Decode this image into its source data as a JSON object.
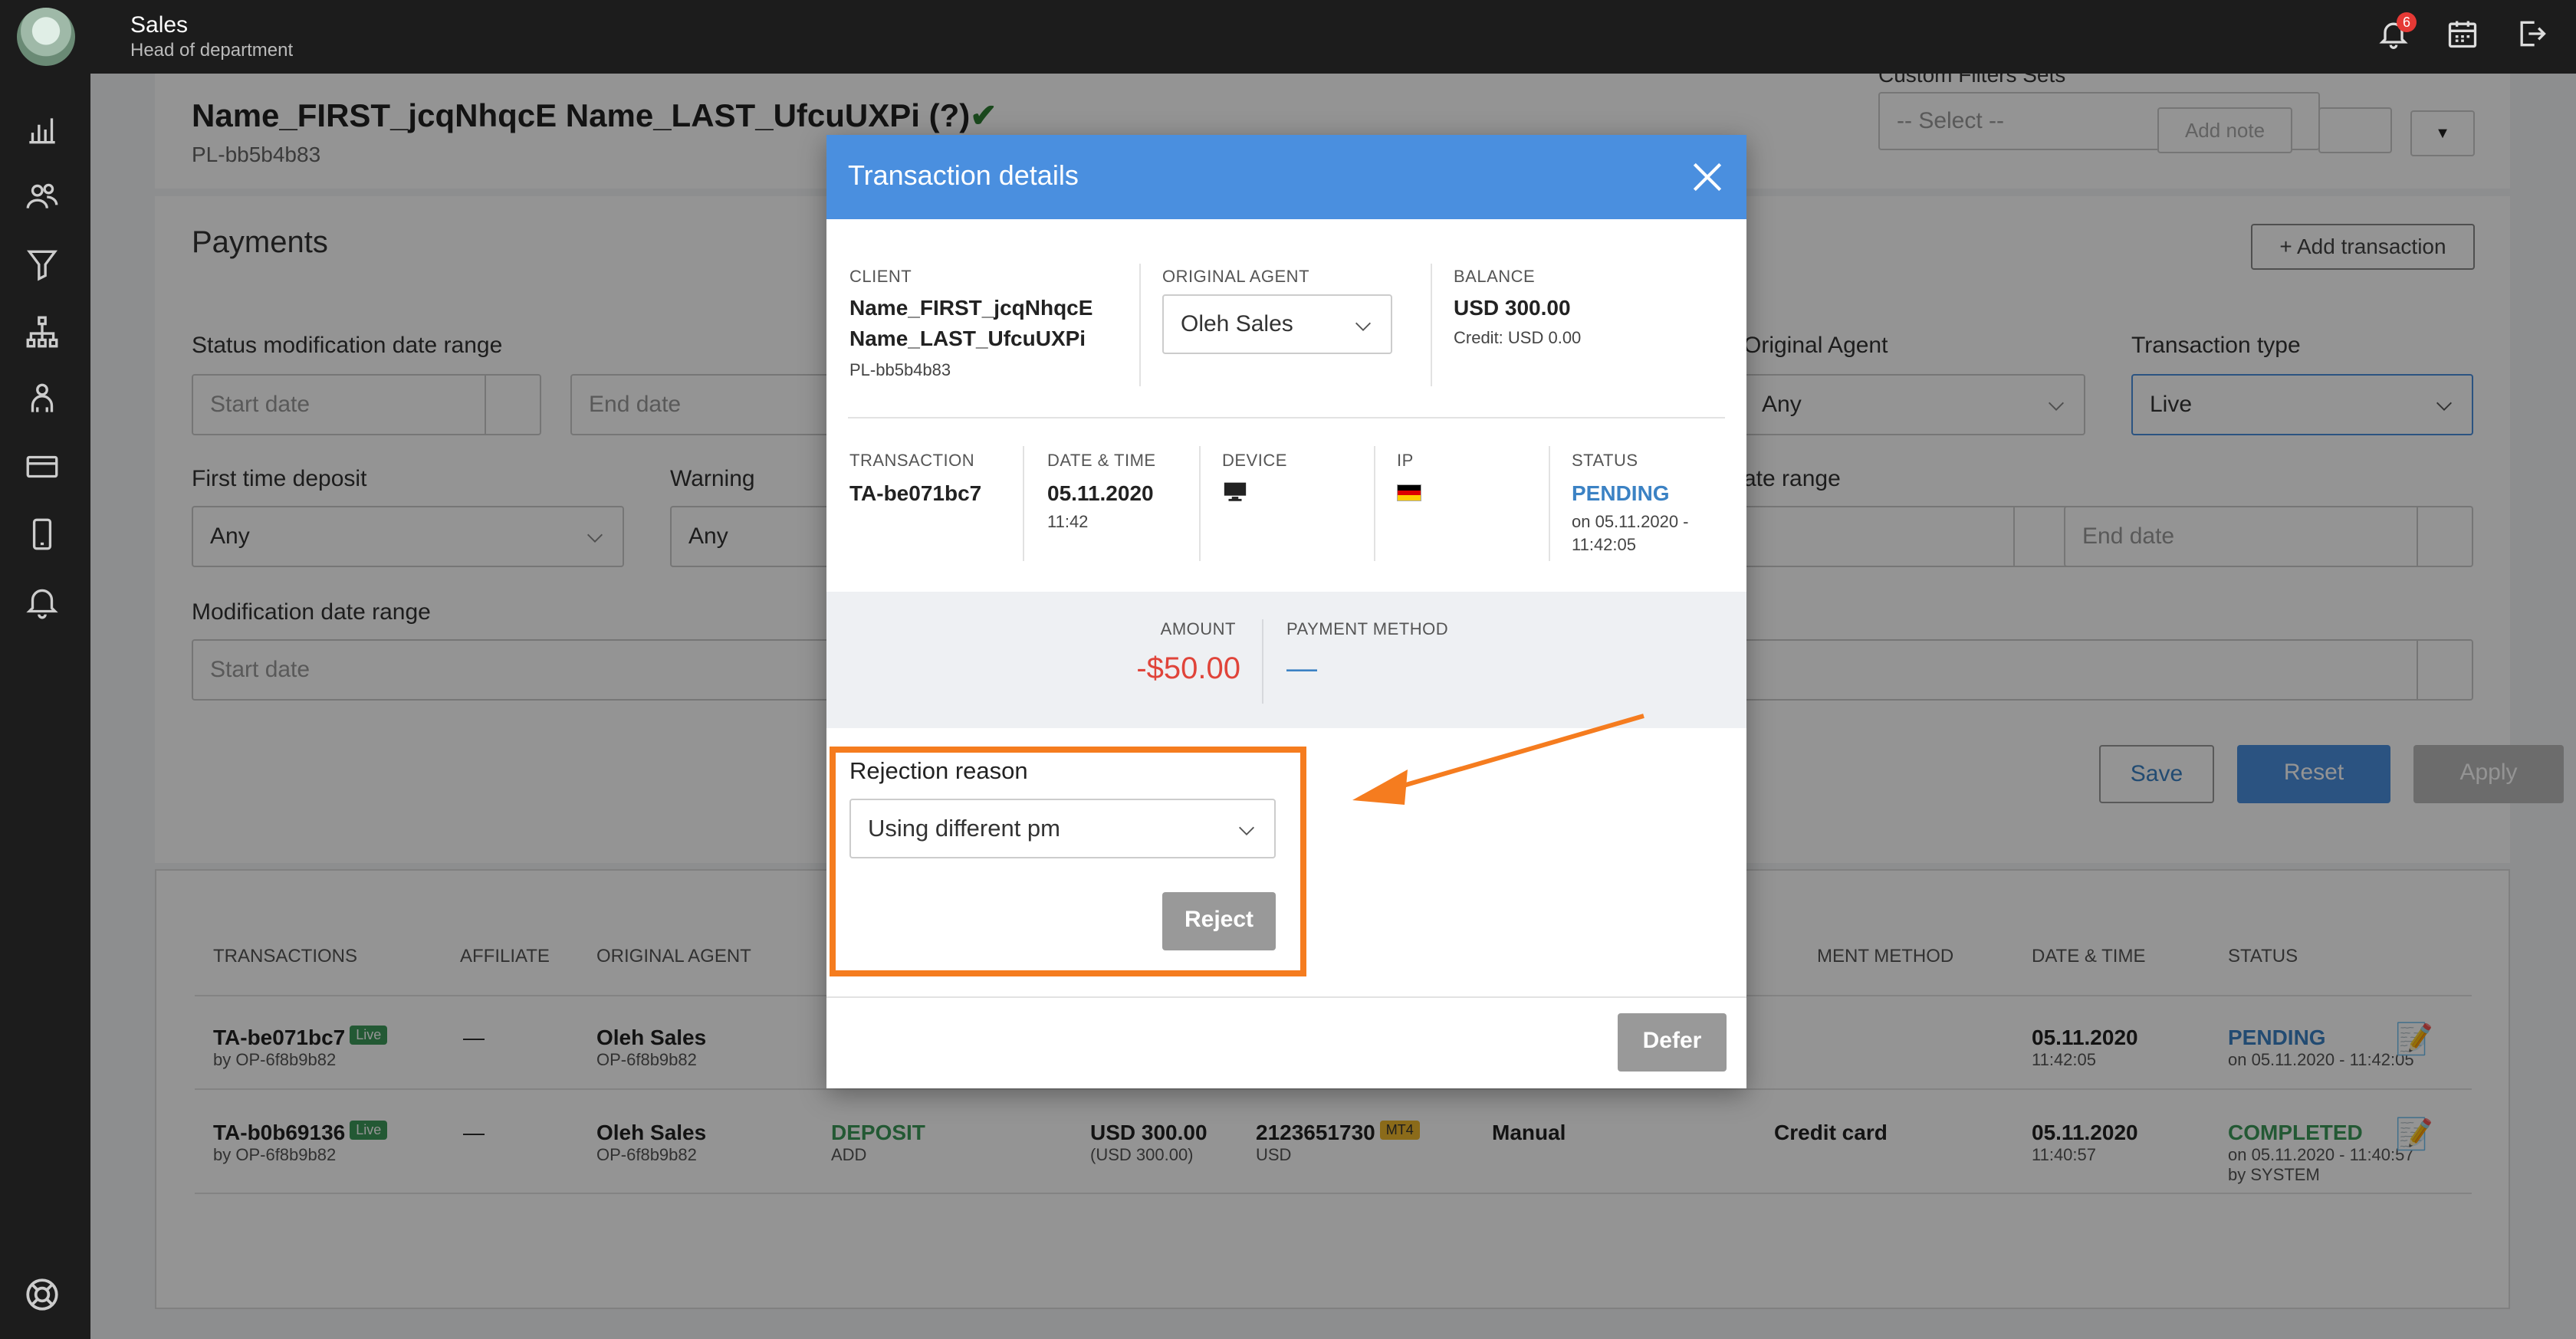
{
  "header": {
    "app_name": "Sales",
    "role": "Head of department",
    "notifications_count": "6"
  },
  "client": {
    "full_name": "Name_FIRST_jcqNhqcE Name_LAST_UfcuUXPi (?)",
    "id": "PL-bb5b4b83"
  },
  "top_controls": {
    "custom_filters_label": "Custom Filters Sets",
    "select_placeholder": "-- Select --",
    "add_note": "Add note"
  },
  "payments": {
    "title": "Payments",
    "add_transaction": "+ Add transaction",
    "filters": {
      "status_mod_label": "Status modification date range",
      "start_date": "Start date",
      "end_date": "End date",
      "original_agent_label": "Original Agent",
      "original_agent_value": "Any",
      "transaction_type_label": "Transaction type",
      "transaction_type_value": "Live",
      "ftd_label": "First time deposit",
      "ftd_value": "Any",
      "warning_label": "Warning",
      "warning_value": "Any",
      "date_range_label": "ate range",
      "modification_label": "Modification date range"
    },
    "buttons": {
      "save": "Save",
      "reset": "Reset",
      "apply": "Apply"
    },
    "table": {
      "headers": [
        "TRANSACTIONS",
        "AFFILIATE",
        "ORIGINAL AGENT",
        "MENT METHOD",
        "DATE & TIME",
        "STATUS"
      ],
      "rows": [
        {
          "id": "TA-be071bc7",
          "tag": "Live",
          "by": "by OP-6f8b9b82",
          "affiliate": "—",
          "agent": "Oleh Sales",
          "agent_id": "OP-6f8b9b82",
          "date": "05.11.2020",
          "time": "11:42:05",
          "status": "PENDING",
          "status_sub": "on 05.11.2020 - 11:42:05"
        },
        {
          "id": "TA-b0b69136",
          "tag": "Live",
          "by": "by OP-6f8b9b82",
          "affiliate": "—",
          "agent": "Oleh Sales",
          "agent_id": "OP-6f8b9b82",
          "type": "DEPOSIT",
          "type_sub": "ADD",
          "amount": "USD 300.00",
          "amount_sub": "(USD 300.00)",
          "account": "2123651730",
          "account_tag": "MT4",
          "account_sub": "USD",
          "source": "Manual",
          "method": "Credit card",
          "date": "05.11.2020",
          "time": "11:40:57",
          "status": "COMPLETED",
          "status_sub": "on 05.11.2020 - 11:40:57",
          "status_by": "by SYSTEM"
        }
      ]
    }
  },
  "modal": {
    "title": "Transaction details",
    "client_label": "CLIENT",
    "client_first": "Name_FIRST_jcqNhqcE",
    "client_last": "Name_LAST_UfcuUXPi",
    "client_id": "PL-bb5b4b83",
    "agent_label": "ORIGINAL AGENT",
    "agent_value": "Oleh Sales",
    "balance_label": "BALANCE",
    "balance_value": "USD 300.00",
    "credit": "Credit: USD 0.00",
    "transaction_label": "TRANSACTION",
    "transaction_value": "TA-be071bc7",
    "datetime_label": "DATE & TIME",
    "date_value": "05.11.2020",
    "time_value": "11:42",
    "device_label": "DEVICE",
    "ip_label": "IP",
    "status_label": "STATUS",
    "status_value": "PENDING",
    "status_sub1": "on 05.11.2020 -",
    "status_sub2": "11:42:05",
    "amount_label": "AMOUNT",
    "amount_value": "-$50.00",
    "payment_method_label": "PAYMENT METHOD",
    "payment_method_value": "—",
    "rejection_label": "Rejection reason",
    "rejection_value": "Using different pm",
    "reject_button": "Reject",
    "defer_button": "Defer"
  },
  "colors": {
    "modal_header": "#4a8fdf",
    "highlight": "#f57c1f",
    "amount_negative": "#e0443a",
    "pending": "#3b82c4",
    "completed": "#3d9a5a"
  }
}
